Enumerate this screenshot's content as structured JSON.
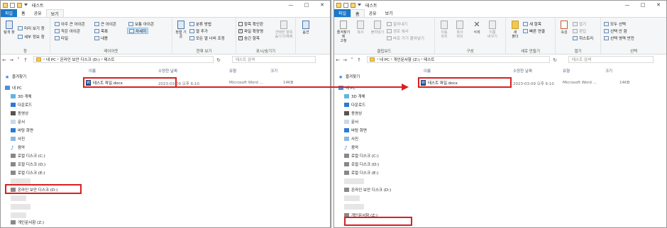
{
  "left": {
    "title": "테스트",
    "tabs": [
      "파일",
      "홈",
      "공유",
      "보기"
    ],
    "ribbon": {
      "pane": {
        "preview": "탐색\n창",
        "preview_pane": "미리 보기 창",
        "details_pane": "세부 정보 창",
        "label": "창"
      },
      "layout": {
        "items": [
          "아주 큰 아이콘",
          "큰 아이콘",
          "보통 아이콘",
          "작은 아이콘",
          "목록",
          "자세히",
          "타일",
          "내용"
        ],
        "label": "레이아웃"
      },
      "current": {
        "sort": "정렬\n기준",
        "group": "분류 방법",
        "addcol": "열 추가",
        "fitcols": "모든 열 너비 조정",
        "label": "현재 보기"
      },
      "showhide": {
        "checkboxes": "항목 확인란",
        "extensions": "파일 확장명",
        "hidden": "숨긴 항목",
        "hide_sel": "선택한 항목\n숨기기/해제",
        "label": "표시/숨기기"
      },
      "options": {
        "btn": "옵션",
        "label": ""
      }
    },
    "address": {
      "parts": [
        "내 PC",
        "온라인 보안 디스크 (D:)",
        "테스트"
      ]
    },
    "search_placeholder": "테스트 검색",
    "nav": {
      "quick": "즐겨찾기",
      "pc": "내 PC",
      "items": [
        "3D 개체",
        "다운로드",
        "동영상",
        "문서",
        "바탕 화면",
        "사진",
        "음악",
        "로컬 디스크 (C:)",
        "로컬 디스크 (D:)",
        "로컬 디스크 (E:)",
        "온라인 보안 디스크 (D:)",
        "개인문서함 (Z:)"
      ]
    },
    "columns": {
      "name": "이름",
      "date": "수정한 날짜",
      "type": "유형",
      "size": "크기"
    },
    "file": {
      "name": "테스트 파일.docx",
      "date": "2023-03-09 오후 6:10",
      "type": "Microsoft Word ...",
      "size": "14KB"
    }
  },
  "right": {
    "title": "테스트",
    "tabs": [
      "파일",
      "홈",
      "공유",
      "보기"
    ],
    "ribbon": {
      "clip": {
        "pin": "즐겨찾기에\n고정",
        "copy": "복사",
        "paste": "붙여넣기",
        "cut": "잘라내기",
        "copypath": "경로 복사",
        "shortcut": "바로 가기 붙여넣기",
        "label": "클립보드"
      },
      "organize": {
        "move": "이동\n위치",
        "copyto": "복사\n위치",
        "delete": "삭제",
        "rename": "이름\n바꾸기",
        "label": "구성"
      },
      "new": {
        "folder": "새\n폴더",
        "newitem": "새 항목",
        "easy": "빠른 연결",
        "label": "새로 만들기"
      },
      "open": {
        "props": "속성",
        "open": "열기",
        "edit": "편집",
        "history": "히스토리",
        "label": "열기"
      },
      "select": {
        "all": "모두 선택",
        "none": "선택 안 함",
        "invert": "선택 영역 반전",
        "label": "선택"
      }
    },
    "address": {
      "parts": [
        "내 PC",
        "개인문서함 (Z:)",
        "테스트"
      ]
    },
    "search_placeholder": "테스트 검색",
    "nav": {
      "quick": "즐겨찾기",
      "pc": "내 PC",
      "items": [
        "3D 개체",
        "다운로드",
        "동영상",
        "문서",
        "바탕 화면",
        "사진",
        "음악",
        "로컬 디스크 (C:)",
        "로컬 디스크 (D:)",
        "로컬 디스크 (E:)",
        "온라인 보안 디스크 (D:)",
        "개인문서함 (Z:)"
      ]
    },
    "columns": {
      "name": "이름",
      "date": "수정한 날짜",
      "type": "유형",
      "size": "크기"
    },
    "file": {
      "name": "테스트 파일.docx",
      "date": "2023-03-09 오후 6:10",
      "type": "Microsoft Word ...",
      "size": "14KB"
    }
  },
  "colors": {
    "accent": "#1979ca",
    "highlight": "#d92020",
    "folder": "#f2c94c"
  }
}
